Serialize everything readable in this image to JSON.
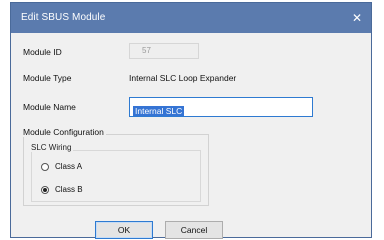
{
  "window": {
    "title": "Edit SBUS Module",
    "close_icon": "close-icon"
  },
  "fields": {
    "module_id_label": "Module ID",
    "module_id_value": "57",
    "module_type_label": "Module Type",
    "module_type_value": "Internal SLC Loop Expander",
    "module_name_label": "Module Name",
    "module_name_value": "Internal SLC"
  },
  "configuration": {
    "group_title": "Module Configuration",
    "slc_wiring_title": "SLC Wiring",
    "options": [
      {
        "label": "Class A",
        "selected": false
      },
      {
        "label": "Class B",
        "selected": true
      }
    ]
  },
  "buttons": {
    "ok_label": "OK",
    "cancel_label": "Cancel"
  },
  "colors": {
    "titlebar": "#5b7bae",
    "selection": "#3574d4",
    "focus_border": "#2e7ad1"
  }
}
